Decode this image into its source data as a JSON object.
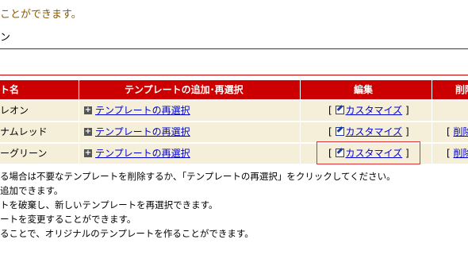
{
  "top_text": "ことができます。",
  "heading": "ン",
  "table": {
    "headers": [
      "ト名",
      "テンプレートの追加･再選択",
      "編集",
      "削除"
    ],
    "rows": [
      {
        "name": "レオン",
        "reselect": "テンプレートの再選択",
        "bracket_open": "[",
        "edit": "カスタマイズ",
        "bracket_close": "]",
        "delete_open": "",
        "delete": ""
      },
      {
        "name": "ナムレッド",
        "reselect": "テンプレートの再選択",
        "bracket_open": "[",
        "edit": "カスタマイズ",
        "bracket_close": "]",
        "delete_open": "[",
        "delete": "削除"
      },
      {
        "name": "ーグリーン",
        "reselect": "テンプレートの再選択",
        "bracket_open": "[",
        "edit": "カスタマイズ",
        "bracket_close": "]",
        "delete_open": "[",
        "delete": "削除"
      }
    ]
  },
  "notes": [
    "る場合は不要なテンプレートを削除するか、「テンプレートの再選択」をクリックしてください。",
    "追加できます。",
    "トを破棄し、新しいテンプレートを再選択できます。",
    "ートを変更することができます。",
    "ることで、オリジナルのテンプレートを作ることができます。"
  ],
  "colors": {
    "header_bg": "#cc0000",
    "row_bg": "#f5efda",
    "link": "#0000cc",
    "highlight": "#dd3333"
  }
}
